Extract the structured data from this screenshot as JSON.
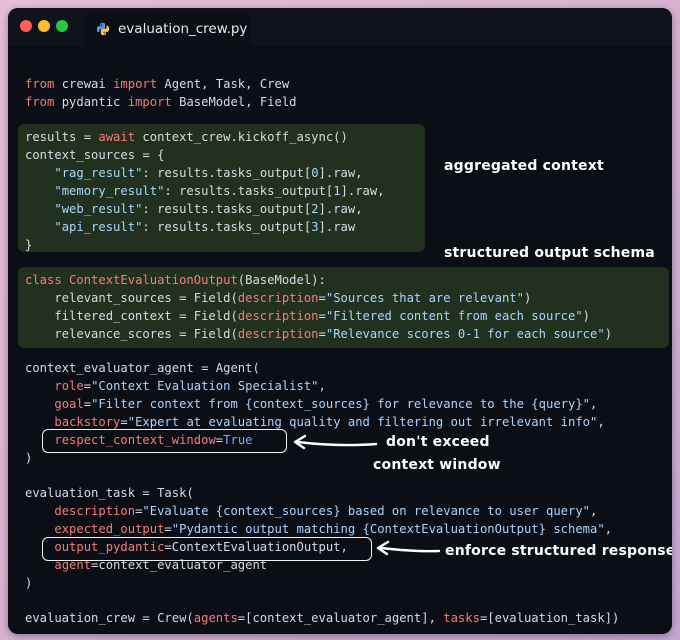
{
  "window": {
    "tab_title": "evaluation_crew.py",
    "tab_icon": "python-icon"
  },
  "code_lines": [
    {
      "id": "l1",
      "tokens": [
        [
          "kw",
          "from"
        ],
        [
          "p",
          " crewai "
        ],
        [
          "kw",
          "import"
        ],
        [
          "p",
          " Agent, Task, Crew"
        ]
      ]
    },
    {
      "id": "l2",
      "tokens": [
        [
          "kw",
          "from"
        ],
        [
          "p",
          " pydantic "
        ],
        [
          "kw",
          "import"
        ],
        [
          "p",
          " BaseModel, Field"
        ]
      ]
    },
    {
      "id": "l3",
      "tokens": [
        [
          "p",
          "results = "
        ],
        [
          "kw",
          "await"
        ],
        [
          "p",
          " context_crew.kickoff_async()"
        ]
      ]
    },
    {
      "id": "l4",
      "tokens": [
        [
          "p",
          "context_sources = {"
        ]
      ]
    },
    {
      "id": "l5",
      "tokens": [
        [
          "p",
          "    "
        ],
        [
          "str",
          "\"rag_result\""
        ],
        [
          "p",
          ": results.tasks_output["
        ],
        [
          "num",
          "0"
        ],
        [
          "p",
          "].raw,"
        ]
      ]
    },
    {
      "id": "l6",
      "tokens": [
        [
          "p",
          "    "
        ],
        [
          "str",
          "\"memory_result\""
        ],
        [
          "p",
          ": results.tasks_output["
        ],
        [
          "num",
          "1"
        ],
        [
          "p",
          "].raw,"
        ]
      ]
    },
    {
      "id": "l7",
      "tokens": [
        [
          "p",
          "    "
        ],
        [
          "str",
          "\"web_result\""
        ],
        [
          "p",
          ": results.tasks_output["
        ],
        [
          "num",
          "2"
        ],
        [
          "p",
          "].raw,"
        ]
      ]
    },
    {
      "id": "l8",
      "tokens": [
        [
          "p",
          "    "
        ],
        [
          "str",
          "\"api_result\""
        ],
        [
          "p",
          ": results.tasks_output["
        ],
        [
          "num",
          "3"
        ],
        [
          "p",
          "].raw"
        ]
      ]
    },
    {
      "id": "l9",
      "tokens": [
        [
          "p",
          "}"
        ]
      ]
    },
    {
      "id": "l10",
      "tokens": [
        [
          "kw",
          "class"
        ],
        [
          "p",
          " "
        ],
        [
          "fn",
          "ContextEvaluationOutput"
        ],
        [
          "p",
          "(BaseModel):"
        ]
      ]
    },
    {
      "id": "l11",
      "tokens": [
        [
          "p",
          "    relevant_sources = Field("
        ],
        [
          "param",
          "description"
        ],
        [
          "p",
          "="
        ],
        [
          "str",
          "\"Sources that are relevant\""
        ],
        [
          "p",
          ")"
        ]
      ]
    },
    {
      "id": "l12",
      "tokens": [
        [
          "p",
          "    filtered_context = Field("
        ],
        [
          "param",
          "description"
        ],
        [
          "p",
          "="
        ],
        [
          "str",
          "\"Filtered content from each source\""
        ],
        [
          "p",
          ")"
        ]
      ]
    },
    {
      "id": "l13",
      "tokens": [
        [
          "p",
          "    relevance_scores = Field("
        ],
        [
          "param",
          "description"
        ],
        [
          "p",
          "="
        ],
        [
          "str",
          "\"Relevance scores 0-1 for each source\""
        ],
        [
          "p",
          ")"
        ]
      ]
    },
    {
      "id": "l14",
      "tokens": [
        [
          "p",
          "context_evaluator_agent = Agent("
        ]
      ]
    },
    {
      "id": "l15",
      "tokens": [
        [
          "p",
          "    "
        ],
        [
          "param",
          "role"
        ],
        [
          "p",
          "="
        ],
        [
          "str",
          "\"Context Evaluation Specialist\""
        ],
        [
          "p",
          ","
        ]
      ]
    },
    {
      "id": "l16",
      "tokens": [
        [
          "p",
          "    "
        ],
        [
          "param",
          "goal"
        ],
        [
          "p",
          "="
        ],
        [
          "str",
          "\"Filter context from {context_sources} for relevance to the {query}\""
        ],
        [
          "p",
          ","
        ]
      ]
    },
    {
      "id": "l17",
      "tokens": [
        [
          "p",
          "    "
        ],
        [
          "param",
          "backstory"
        ],
        [
          "p",
          "="
        ],
        [
          "str",
          "\"Expert at evaluating quality and filtering out irrelevant info\""
        ],
        [
          "p",
          ","
        ]
      ]
    },
    {
      "id": "l18",
      "tokens": [
        [
          "p",
          "    "
        ],
        [
          "param",
          "respect_context_window"
        ],
        [
          "p",
          "="
        ],
        [
          "kw-blue",
          "True"
        ]
      ]
    },
    {
      "id": "l19",
      "tokens": [
        [
          "p",
          ")"
        ]
      ]
    },
    {
      "id": "l20",
      "tokens": [
        [
          "p",
          "evaluation_task = Task("
        ]
      ]
    },
    {
      "id": "l21",
      "tokens": [
        [
          "p",
          "    "
        ],
        [
          "param",
          "description"
        ],
        [
          "p",
          "="
        ],
        [
          "str",
          "\"Evaluate {context_sources} based on relevance to user query\""
        ],
        [
          "p",
          ","
        ]
      ]
    },
    {
      "id": "l22",
      "tokens": [
        [
          "p",
          "    "
        ],
        [
          "param",
          "expected_output"
        ],
        [
          "p",
          "="
        ],
        [
          "str",
          "\"Pydantic output matching {ContextEvaluationOutput} schema\""
        ],
        [
          "p",
          ","
        ]
      ]
    },
    {
      "id": "l23",
      "tokens": [
        [
          "p",
          "    "
        ],
        [
          "param",
          "output_pydantic"
        ],
        [
          "p",
          "=ContextEvaluationOutput,"
        ]
      ]
    },
    {
      "id": "l24",
      "tokens": [
        [
          "p",
          "    "
        ],
        [
          "param",
          "agent"
        ],
        [
          "p",
          "=context_evaluator_agent"
        ]
      ]
    },
    {
      "id": "l25",
      "tokens": [
        [
          "p",
          ")"
        ]
      ]
    },
    {
      "id": "l26",
      "tokens": [
        [
          "p",
          "evaluation_crew = Crew("
        ],
        [
          "param",
          "agents"
        ],
        [
          "p",
          "=[context_evaluator_agent], "
        ],
        [
          "param",
          "tasks"
        ],
        [
          "p",
          "=[evaluation_task])"
        ]
      ]
    }
  ],
  "annotations": {
    "aggregated": "aggregated context",
    "schema": "structured output schema",
    "no_exceed_1": "don't exceed",
    "no_exceed_2": "context window",
    "enforce": "enforce structured response"
  },
  "colors": {
    "keyword": "#f47c7c",
    "string": "#a8d6ff",
    "plain": "#d7dbe3",
    "highlight": "#22301f",
    "background": "#0b0e14"
  }
}
